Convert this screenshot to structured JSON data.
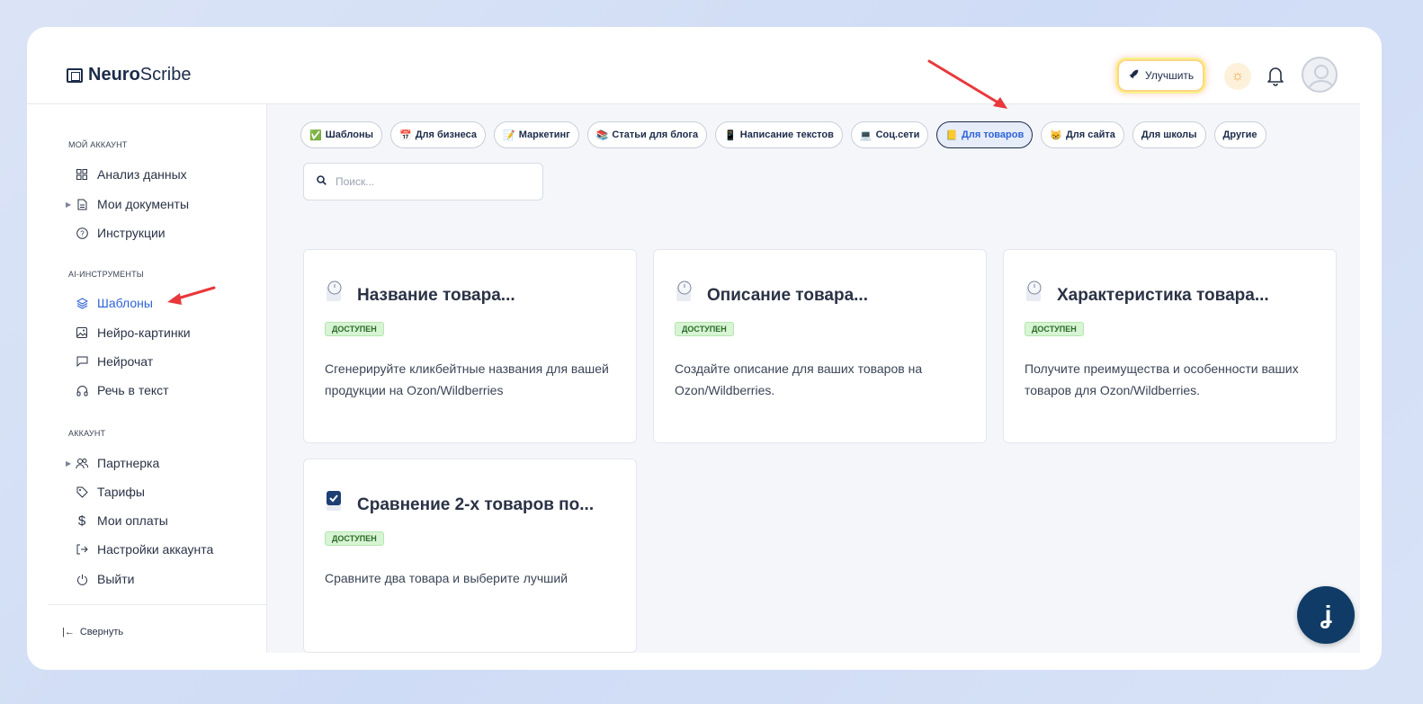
{
  "app": {
    "logo_bold": "Neuro",
    "logo_rest": "Scribe"
  },
  "header": {
    "upgrade_label": "Улучшить"
  },
  "sidebar": {
    "section_my_account": "Мой аккаунт",
    "section_ai_tools": "AI-инструменты",
    "section_account": "Аккаунт",
    "items": {
      "analytics": "Анализ данных",
      "documents": "Мои документы",
      "instructions": "Инструкции",
      "templates": "Шаблоны",
      "neuro_images": "Нейро-картинки",
      "neuro_chat": "Нейрочат",
      "speech_to_text": "Речь в текст",
      "partner": "Партнерка",
      "tariffs": "Тарифы",
      "payments": "Мои оплаты",
      "settings": "Настройки аккаунта",
      "logout": "Выйти"
    },
    "collapse_label": "Свернуть"
  },
  "categories": [
    {
      "icon": "✅",
      "label": "Шаблоны"
    },
    {
      "icon": "📅",
      "label": "Для бизнеса"
    },
    {
      "icon": "📝",
      "label": "Маркетинг"
    },
    {
      "icon": "📚",
      "label": "Статьи для блога"
    },
    {
      "icon": "📱",
      "label": "Написание текстов"
    },
    {
      "icon": "💻",
      "label": "Соц.сети"
    },
    {
      "icon": "📒",
      "label": "Для товаров"
    },
    {
      "icon": "😸",
      "label": "Для сайта"
    },
    {
      "icon": "",
      "label": "Для школы"
    },
    {
      "icon": "",
      "label": "Другие"
    }
  ],
  "active_category": "Для товаров",
  "search": {
    "placeholder": "Поиск..."
  },
  "cards": [
    {
      "title": "Название товара...",
      "badge": "доступен",
      "desc": "Сгенерируйте кликбейтные названия для вашей продукции на Ozon/Wildberries"
    },
    {
      "title": "Описание товара...",
      "badge": "доступен",
      "desc": "Создайте описание для ваших товаров на Ozon/Wildberries."
    },
    {
      "title": "Характеристика товара...",
      "badge": "доступен",
      "desc": "Получите преимущества и особенности ваших товаров для Ozon/Wildberries."
    },
    {
      "title": "Сравнение 2-х товаров по...",
      "badge": "доступен",
      "desc": "Сравните два товара и выберите лучший"
    }
  ],
  "fab_label": "ʝ",
  "colors": {
    "accent": "#2e63d8",
    "text": "#1c2b4a",
    "badge_bg": "#d7f4d4",
    "fab": "#0f3b66",
    "annotation": "#e8383b"
  }
}
